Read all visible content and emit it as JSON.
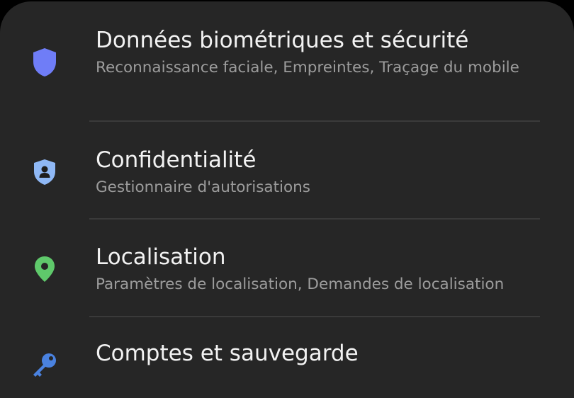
{
  "settings": {
    "items": [
      {
        "id": "biometrics",
        "icon": "shield-icon",
        "icon_color": "#6f7df7",
        "title": "Données biométriques et sécurité",
        "subtitle": "Reconnaissance faciale, Empreintes, Traçage du mobile"
      },
      {
        "id": "privacy",
        "icon": "privacy-shield-icon",
        "icon_color": "#8fb8f5",
        "title": "Confidentialité",
        "subtitle": "Gestionnaire d'autorisations"
      },
      {
        "id": "location",
        "icon": "location-pin-icon",
        "icon_color": "#5fc96b",
        "title": "Localisation",
        "subtitle": "Paramètres de localisation, Demandes de localisation"
      },
      {
        "id": "accounts",
        "icon": "key-icon",
        "icon_color": "#4a82e0",
        "title": "Comptes et sauvegarde",
        "subtitle": ""
      }
    ]
  }
}
